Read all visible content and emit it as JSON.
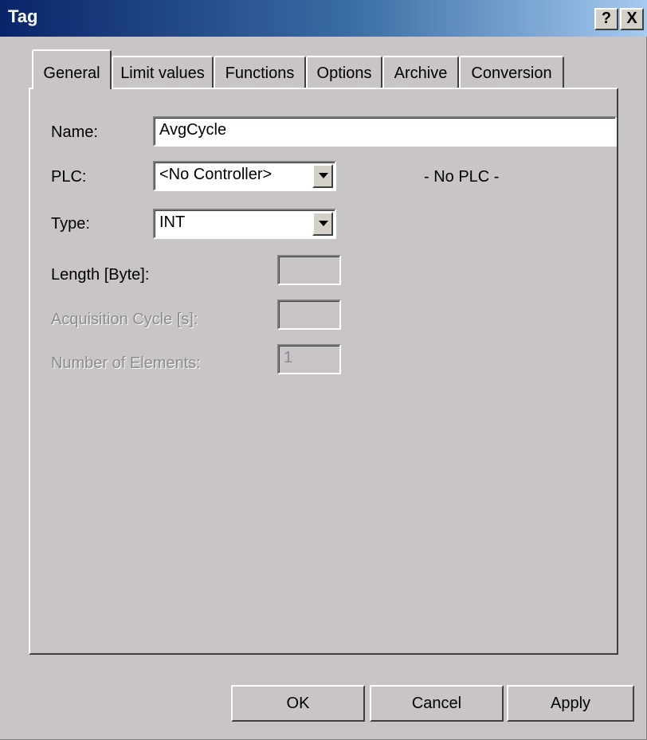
{
  "window": {
    "title": "Tag",
    "help_glyph": "?",
    "close_glyph": "X"
  },
  "tabs": [
    {
      "label": "General",
      "active": true
    },
    {
      "label": "Limit values",
      "active": false
    },
    {
      "label": "Functions",
      "active": false
    },
    {
      "label": "Options",
      "active": false
    },
    {
      "label": "Archive",
      "active": false
    },
    {
      "label": "Conversion",
      "active": false
    }
  ],
  "general": {
    "name_label": "Name:",
    "name_value": "AvgCycle",
    "plc_label": "PLC:",
    "plc_value": "<No Controller>",
    "plc_status": "- No PLC -",
    "type_label": "Type:",
    "type_value": "INT",
    "length_label": "Length [Byte]:",
    "length_value": "",
    "acq_label": "Acquisition Cycle [s]:",
    "acq_value": "",
    "elements_label": "Number of Elements:",
    "elements_value": "1"
  },
  "buttons": {
    "ok": "OK",
    "cancel": "Cancel",
    "apply": "Apply"
  }
}
